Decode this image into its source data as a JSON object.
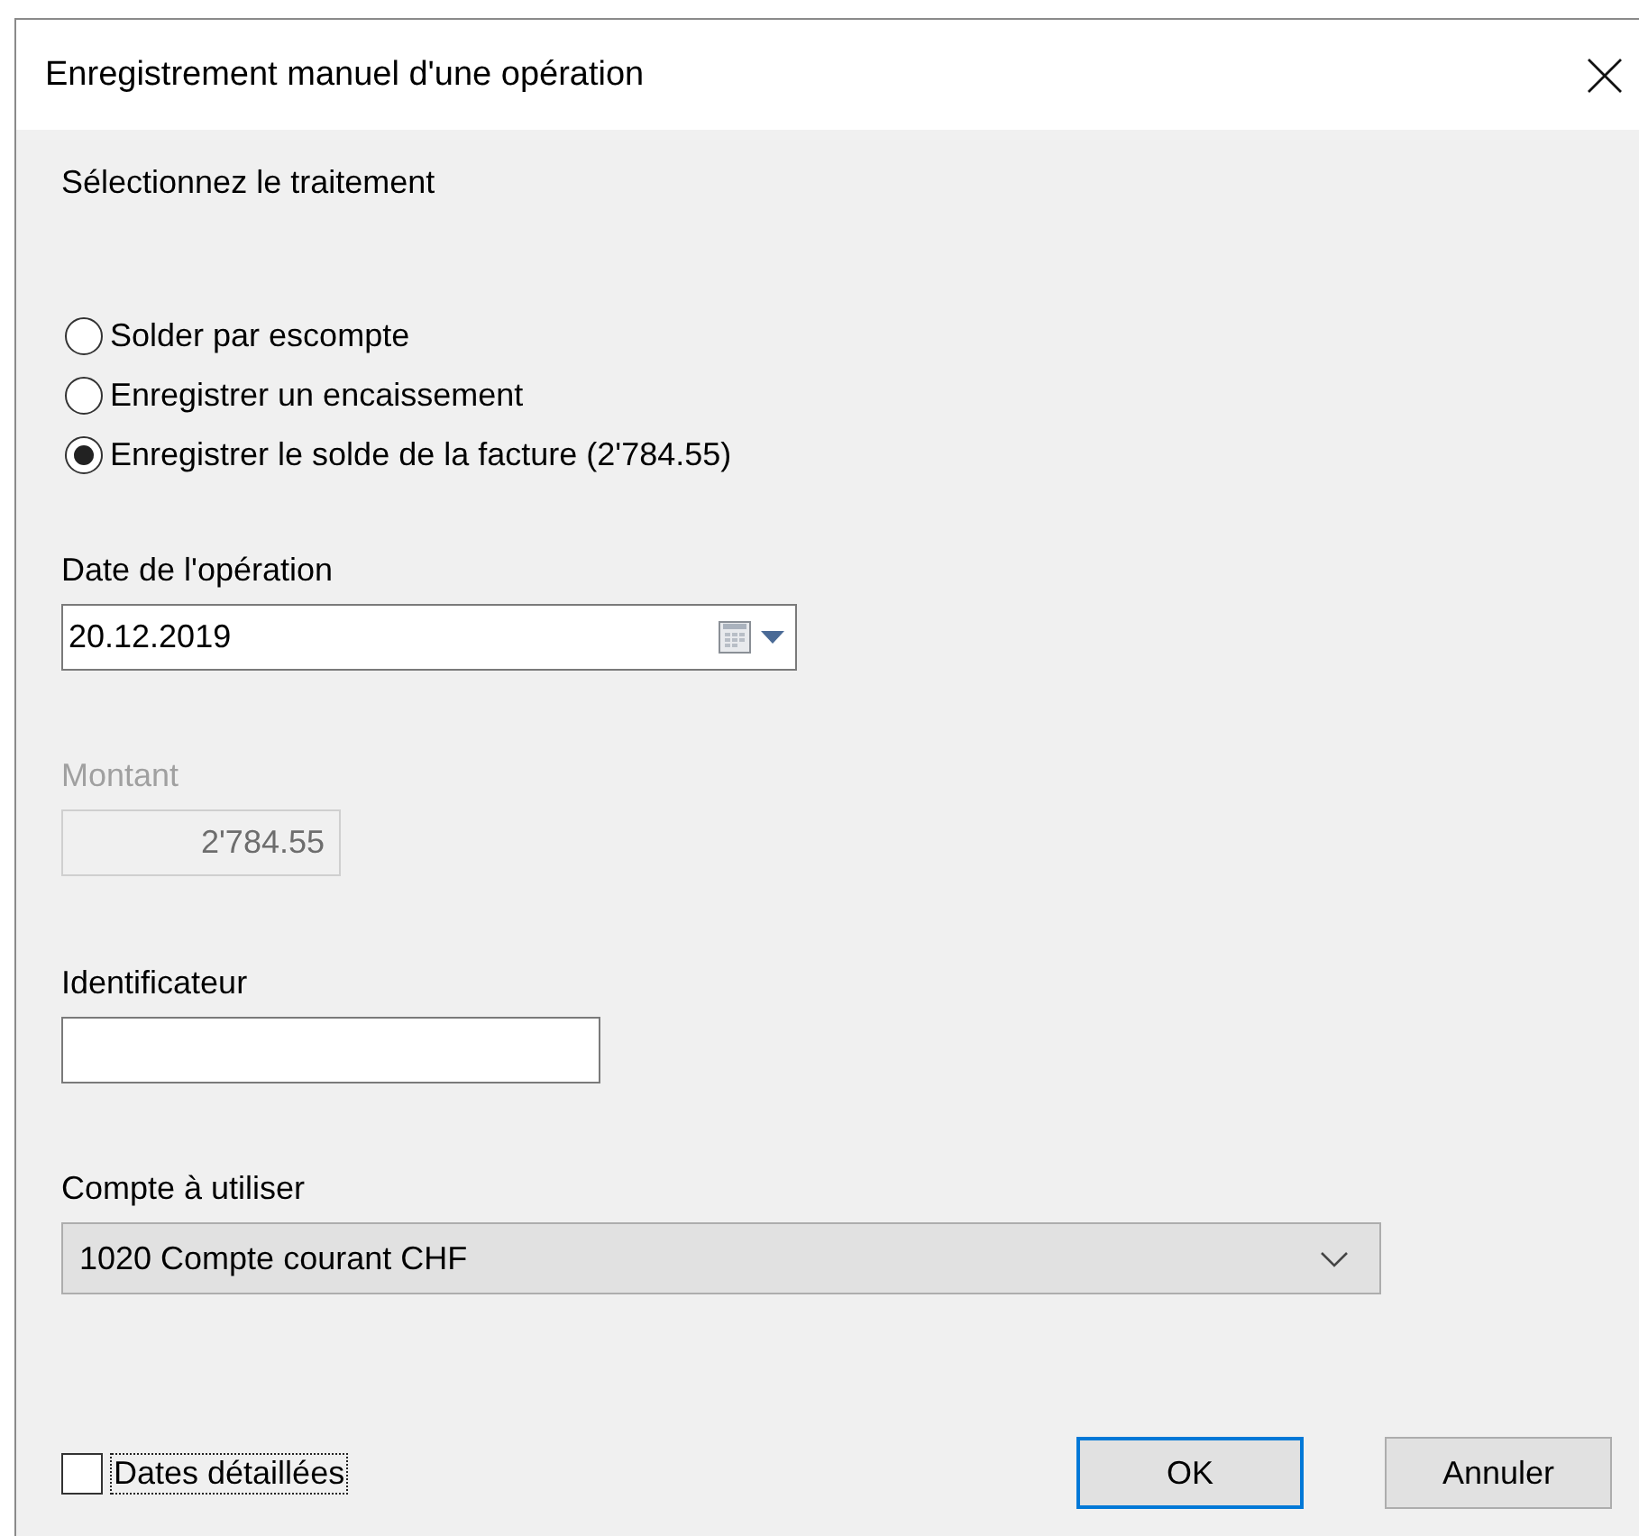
{
  "window": {
    "title": "Enregistrement manuel d'une opération"
  },
  "prompt": "Sélectionnez le traitement",
  "treatments": [
    {
      "label": "Solder par escompte",
      "selected": false
    },
    {
      "label": "Enregistrer un encaissement",
      "selected": false
    },
    {
      "label": "Enregistrer le solde de la facture (2'784.55)",
      "selected": true
    }
  ],
  "date": {
    "label": "Date de l'opération",
    "value": "20.12.2019"
  },
  "amount": {
    "label": "Montant",
    "value": "2'784.55",
    "disabled": true
  },
  "identifier": {
    "label": "Identificateur"
  },
  "account": {
    "label": "Compte à utiliser",
    "value": "1020 Compte courant CHF"
  },
  "detailed_dates": {
    "label": "Dates détaillées",
    "checked": false,
    "focused": true
  },
  "buttons": [
    {
      "label": "OK",
      "default": true
    },
    {
      "label": "Annuler",
      "default": false
    }
  ]
}
